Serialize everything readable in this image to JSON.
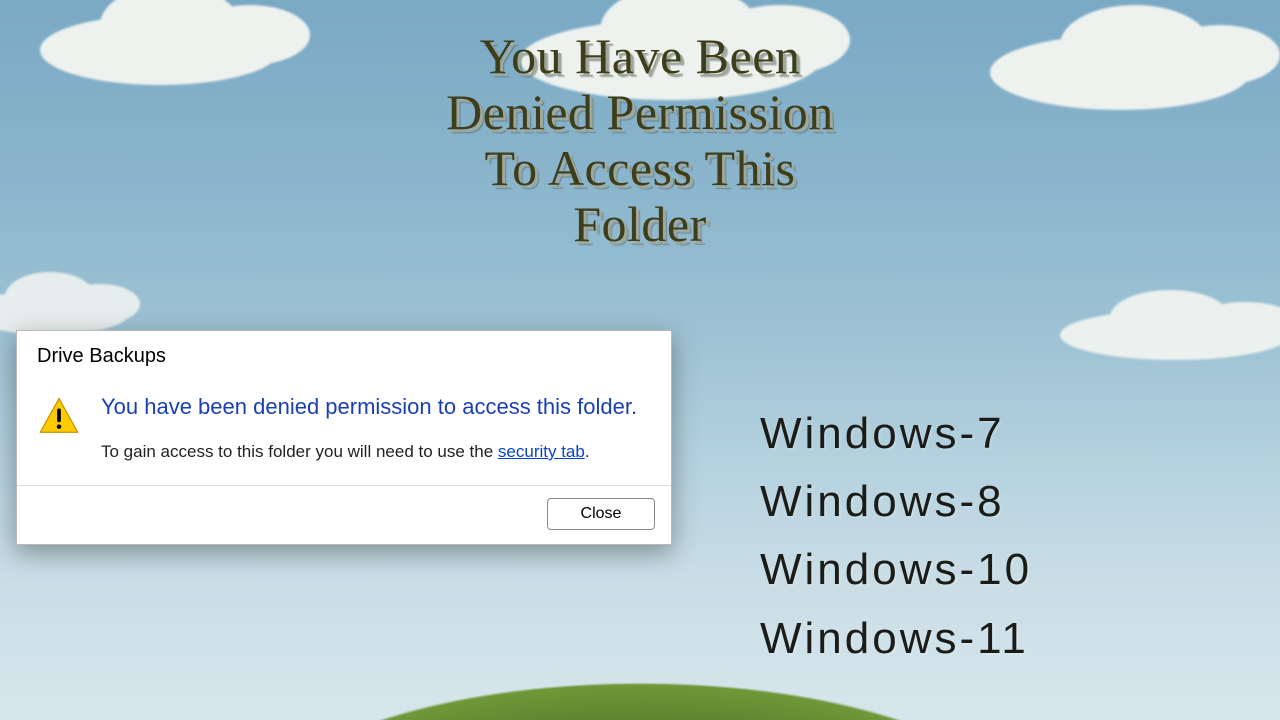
{
  "headline": {
    "line1": "You Have Been",
    "line2": "Denied Permission",
    "line3": "To Access This",
    "line4": "Folder"
  },
  "os_list": [
    "Windows-7",
    "Windows-8",
    "Windows-10",
    "Windows-11"
  ],
  "dialog": {
    "title": "Drive Backups",
    "main_message": "You have been denied permission to access this folder.",
    "sub_message_prefix": "To gain access to this folder you will need to use the ",
    "sub_link_text": "security tab",
    "sub_message_suffix": ".",
    "close_label": "Close",
    "icon_name": "warning-icon"
  },
  "colors": {
    "headline": "#3e3e1d",
    "dialog_main": "#1a3fb5",
    "link": "#0645cc",
    "warn_fill": "#ffcc00",
    "warn_stroke": "#e0a800"
  }
}
